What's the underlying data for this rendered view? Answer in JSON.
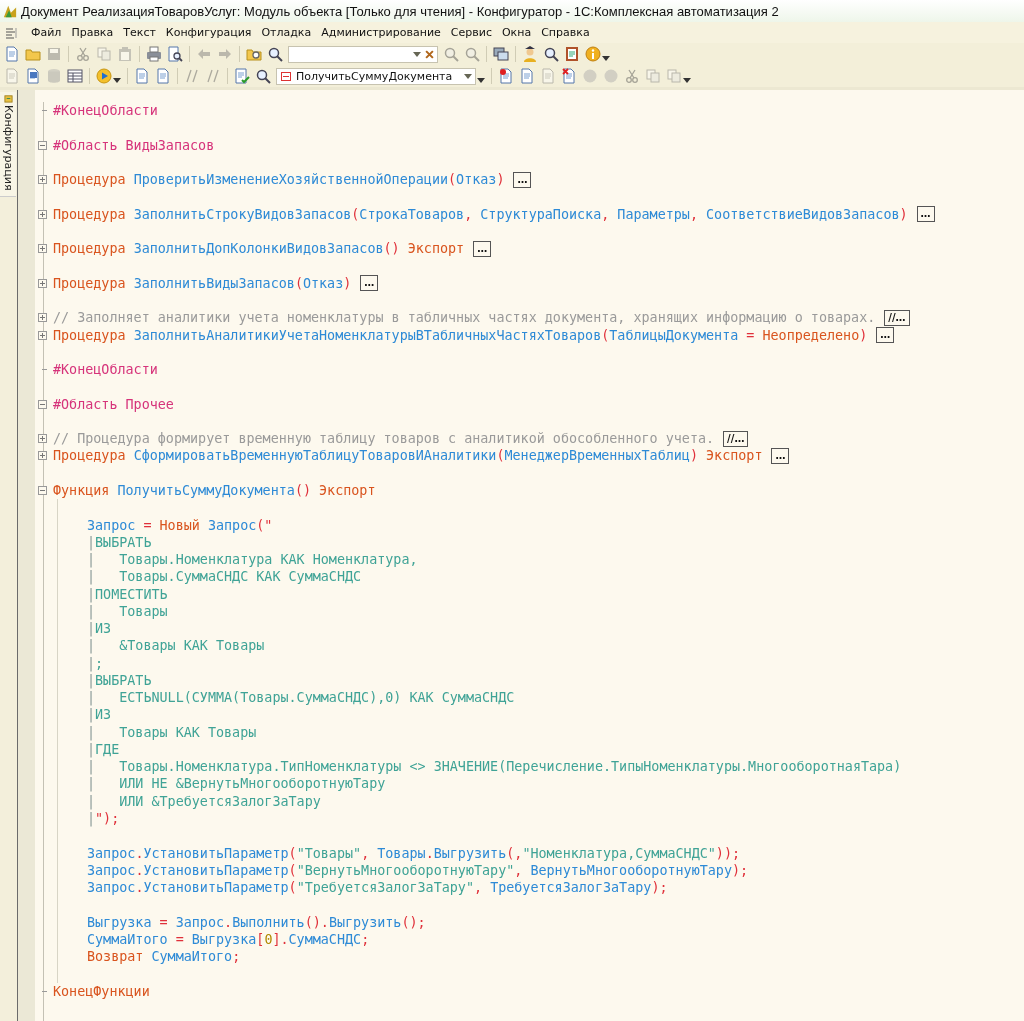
{
  "window": {
    "title": "Документ РеализацияТоваровУслуг: Модуль объекта [Только для чтения] - Конфигуратор - 1С:Комплексная автоматизация 2"
  },
  "menu": [
    "Файл",
    "Правка",
    "Текст",
    "Конфигурация",
    "Отладка",
    "Администрирование",
    "Сервис",
    "Окна",
    "Справка"
  ],
  "toolbars": [
    {
      "buttons": [
        {
          "disabled": false
        },
        {
          "disabled": false
        },
        {
          "disabled": true
        },
        {
          "disabled": true
        },
        {
          "disabled": true
        },
        {
          "disabled": true
        },
        {
          "disabled": false
        },
        {
          "disabled": false
        },
        {
          "disabled": true
        },
        {
          "disabled": true
        },
        {
          "disabled": false
        },
        {
          "disabled": false
        },
        {
          "disabled": true
        },
        {
          "disabled": true
        },
        {
          "disabled": false
        },
        {
          "disabled": false
        },
        {
          "disabled": false
        },
        {
          "disabled": false
        },
        {
          "disabled": false
        }
      ]
    },
    {
      "buttons": [
        {
          "disabled": true
        },
        {
          "disabled": false
        },
        {
          "disabled": true
        },
        {
          "disabled": false
        },
        {
          "disabled": false
        },
        {
          "disabled": false
        },
        {
          "disabled": false
        },
        {
          "disabled": true
        },
        {
          "disabled": true
        },
        {
          "disabled": false
        },
        {
          "disabled": false
        },
        {
          "disabled": false
        },
        {
          "disabled": false
        },
        {
          "disabled": true
        },
        {
          "disabled": false
        },
        {
          "disabled": true
        },
        {
          "disabled": true
        },
        {
          "disabled": true
        },
        {
          "disabled": true
        },
        {
          "disabled": true
        }
      ]
    }
  ],
  "method_selector": {
    "value": "ПолучитьСуммуДокумента"
  },
  "side_tab": {
    "label": "Конфигурация"
  },
  "editor": {
    "lines": [
      {
        "kind": "block_end",
        "tokens": [
          {
            "t": "#КонецОбласти",
            "kind": "rg"
          }
        ]
      },
      {
        "kind": "blank"
      },
      {
        "kind": "block",
        "expanded": true,
        "tokens": [
          {
            "t": "#Область ВидыЗапасов",
            "kind": "rg"
          }
        ]
      },
      {
        "kind": "blank"
      },
      {
        "kind": "block",
        "expanded": false,
        "folded_label": "…",
        "tokens": [
          {
            "t": "Процедура ",
            "kind": "kw"
          },
          {
            "t": "ПроверитьИзменениеХозяйственнойОперации",
            "kind": "id"
          },
          {
            "t": "(",
            "kind": "p"
          },
          {
            "t": "Отказ",
            "kind": "id"
          },
          {
            "t": ")",
            "kind": "p"
          }
        ]
      },
      {
        "kind": "blank"
      },
      {
        "kind": "block",
        "expanded": false,
        "folded_label": "…",
        "tokens": [
          {
            "t": "Процедура ",
            "kind": "kw"
          },
          {
            "t": "ЗаполнитьСтрокуВидовЗапасов",
            "kind": "id"
          },
          {
            "t": "(",
            "kind": "p"
          },
          {
            "t": "СтрокаТоваров",
            "kind": "id"
          },
          {
            "t": ", ",
            "kind": "p"
          },
          {
            "t": "СтруктураПоиска",
            "kind": "id"
          },
          {
            "t": ", ",
            "kind": "p"
          },
          {
            "t": "Параметры",
            "kind": "id"
          },
          {
            "t": ", ",
            "kind": "p"
          },
          {
            "t": "СоответствиеВидовЗапасов",
            "kind": "id"
          },
          {
            "t": ")",
            "kind": "p"
          }
        ]
      },
      {
        "kind": "blank"
      },
      {
        "kind": "block",
        "expanded": false,
        "folded_label": "…",
        "tokens": [
          {
            "t": "Процедура ",
            "kind": "kw"
          },
          {
            "t": "ЗаполнитьДопКолонкиВидовЗапасов",
            "kind": "id"
          },
          {
            "t": "() ",
            "kind": "p"
          },
          {
            "t": "Экспорт",
            "kind": "kw"
          }
        ]
      },
      {
        "kind": "blank"
      },
      {
        "kind": "block",
        "expanded": false,
        "folded_label": "…",
        "tokens": [
          {
            "t": "Процедура ",
            "kind": "kw"
          },
          {
            "t": "ЗаполнитьВидыЗапасов",
            "kind": "id"
          },
          {
            "t": "(",
            "kind": "p"
          },
          {
            "t": "Отказ",
            "kind": "id"
          },
          {
            "t": ")",
            "kind": "p"
          }
        ]
      },
      {
        "kind": "blank"
      },
      {
        "kind": "block",
        "expanded": false,
        "folded_label": "//…",
        "tokens": [
          {
            "t": "// Заполняет аналитики учета номенклатуры в табличных частях документа, хранящих информацию о товарах.",
            "kind": "cm"
          }
        ]
      },
      {
        "kind": "block",
        "expanded": false,
        "folded_label": "…",
        "tokens": [
          {
            "t": "Процедура ",
            "kind": "kw"
          },
          {
            "t": "ЗаполнитьАналитикиУчетаНоменклатурыВТабличныхЧастяхТоваров",
            "kind": "id"
          },
          {
            "t": "(",
            "kind": "p"
          },
          {
            "t": "ТаблицыДокумента ",
            "kind": "id"
          },
          {
            "t": "= ",
            "kind": "p"
          },
          {
            "t": "Неопределено",
            "kind": "kw"
          },
          {
            "t": ")",
            "kind": "p"
          }
        ]
      },
      {
        "kind": "blank"
      },
      {
        "kind": "block_end",
        "tokens": [
          {
            "t": "#КонецОбласти",
            "kind": "rg"
          }
        ]
      },
      {
        "kind": "blank"
      },
      {
        "kind": "block",
        "expanded": true,
        "tokens": [
          {
            "t": "#Область Прочее",
            "kind": "rg"
          }
        ]
      },
      {
        "kind": "blank"
      },
      {
        "kind": "block",
        "expanded": false,
        "folded_label": "//…",
        "tokens": [
          {
            "t": "// Процедура формирует временную таблицу товаров с аналитикой обособленного учета.",
            "kind": "cm"
          }
        ]
      },
      {
        "kind": "block",
        "expanded": false,
        "folded_label": "…",
        "tokens": [
          {
            "t": "Процедура ",
            "kind": "kw"
          },
          {
            "t": "СформироватьВременнуюТаблицуТоваровИАналитики",
            "kind": "id"
          },
          {
            "t": "(",
            "kind": "p"
          },
          {
            "t": "МенеджерВременныхТаблиц",
            "kind": "id"
          },
          {
            "t": ") ",
            "kind": "p"
          },
          {
            "t": "Экспорт",
            "kind": "kw"
          }
        ]
      },
      {
        "kind": "blank"
      },
      {
        "kind": "block",
        "expanded": true,
        "tokens": [
          {
            "t": "Функция ",
            "kind": "kw"
          },
          {
            "t": "ПолучитьСуммуДокумента",
            "kind": "id"
          },
          {
            "t": "() ",
            "kind": "p"
          },
          {
            "t": "Экспорт",
            "kind": "kw"
          }
        ],
        "children": [
          {
            "kind": "blank"
          },
          {
            "kind": "code",
            "tokens": [
              {
                "t": "Запрос ",
                "kind": "id"
              },
              {
                "t": "= ",
                "kind": "p"
              },
              {
                "t": "Новый ",
                "kind": "kw"
              },
              {
                "t": "Запрос",
                "kind": "id"
              },
              {
                "t": "(\"",
                "kind": "p"
              }
            ]
          },
          {
            "kind": "code",
            "tokens": [
              {
                "t": "|",
                "kind": "pipe"
              },
              {
                "t": "ВЫБРАТЬ",
                "kind": "q"
              }
            ]
          },
          {
            "kind": "code",
            "tokens": [
              {
                "t": "|",
                "kind": "pipe"
              },
              {
                "t": "   Товары.Номенклатура КАК Номенклатура,",
                "kind": "q"
              }
            ]
          },
          {
            "kind": "code",
            "tokens": [
              {
                "t": "|",
                "kind": "pipe"
              },
              {
                "t": "   Товары.СуммаСНДС КАК СуммаСНДС",
                "kind": "q"
              }
            ]
          },
          {
            "kind": "code",
            "tokens": [
              {
                "t": "|",
                "kind": "pipe"
              },
              {
                "t": "ПОМЕСТИТЬ",
                "kind": "q"
              }
            ]
          },
          {
            "kind": "code",
            "tokens": [
              {
                "t": "|",
                "kind": "pipe"
              },
              {
                "t": "   Товары",
                "kind": "q"
              }
            ]
          },
          {
            "kind": "code",
            "tokens": [
              {
                "t": "|",
                "kind": "pipe"
              },
              {
                "t": "ИЗ",
                "kind": "q"
              }
            ]
          },
          {
            "kind": "code",
            "tokens": [
              {
                "t": "|",
                "kind": "pipe"
              },
              {
                "t": "   &Товары КАК Товары",
                "kind": "q"
              }
            ]
          },
          {
            "kind": "code",
            "tokens": [
              {
                "t": "|",
                "kind": "pipe"
              },
              {
                "t": ";",
                "kind": "q"
              }
            ]
          },
          {
            "kind": "code",
            "tokens": [
              {
                "t": "|",
                "kind": "pipe"
              },
              {
                "t": "ВЫБРАТЬ",
                "kind": "q"
              }
            ]
          },
          {
            "kind": "code",
            "tokens": [
              {
                "t": "|",
                "kind": "pipe"
              },
              {
                "t": "   ЕСТЬNULL(СУММА(Товары.СуммаСНДС),0) КАК СуммаСНДС",
                "kind": "q"
              }
            ]
          },
          {
            "kind": "code",
            "tokens": [
              {
                "t": "|",
                "kind": "pipe"
              },
              {
                "t": "ИЗ",
                "kind": "q"
              }
            ]
          },
          {
            "kind": "code",
            "tokens": [
              {
                "t": "|",
                "kind": "pipe"
              },
              {
                "t": "   Товары КАК Товары",
                "kind": "q"
              }
            ]
          },
          {
            "kind": "code",
            "tokens": [
              {
                "t": "|",
                "kind": "pipe"
              },
              {
                "t": "ГДЕ",
                "kind": "q"
              }
            ]
          },
          {
            "kind": "code",
            "tokens": [
              {
                "t": "|",
                "kind": "pipe"
              },
              {
                "t": "   Товары.Номенклатура.ТипНоменклатуры <> ЗНАЧЕНИЕ(Перечисление.ТипыНоменклатуры.МногооборотнаяТара)",
                "kind": "q"
              }
            ]
          },
          {
            "kind": "code",
            "tokens": [
              {
                "t": "|",
                "kind": "pipe"
              },
              {
                "t": "   ИЛИ НЕ &ВернутьМногооборотнуюТару",
                "kind": "q"
              }
            ]
          },
          {
            "kind": "code",
            "tokens": [
              {
                "t": "|",
                "kind": "pipe"
              },
              {
                "t": "   ИЛИ &ТребуетсяЗалогЗаТару",
                "kind": "q"
              }
            ]
          },
          {
            "kind": "code",
            "tokens": [
              {
                "t": "|",
                "kind": "pipe"
              },
              {
                "t": "\");",
                "kind": "p"
              }
            ]
          },
          {
            "kind": "blank"
          },
          {
            "kind": "code",
            "tokens": [
              {
                "t": "Запрос",
                "kind": "id"
              },
              {
                "t": ".",
                "kind": "p"
              },
              {
                "t": "УстановитьПараметр",
                "kind": "id"
              },
              {
                "t": "(",
                "kind": "p"
              },
              {
                "t": "\"Товары\"",
                "kind": "q"
              },
              {
                "t": ", ",
                "kind": "p"
              },
              {
                "t": "Товары",
                "kind": "id"
              },
              {
                "t": ".",
                "kind": "p"
              },
              {
                "t": "Выгрузить",
                "kind": "id"
              },
              {
                "t": "(,",
                "kind": "p"
              },
              {
                "t": "\"Номенклатура,СуммаСНДС\"",
                "kind": "q"
              },
              {
                "t": "));",
                "kind": "p"
              }
            ]
          },
          {
            "kind": "code",
            "tokens": [
              {
                "t": "Запрос",
                "kind": "id"
              },
              {
                "t": ".",
                "kind": "p"
              },
              {
                "t": "УстановитьПараметр",
                "kind": "id"
              },
              {
                "t": "(",
                "kind": "p"
              },
              {
                "t": "\"ВернутьМногооборотнуюТару\"",
                "kind": "q"
              },
              {
                "t": ", ",
                "kind": "p"
              },
              {
                "t": "ВернутьМногооборотнуюТару",
                "kind": "id"
              },
              {
                "t": ");",
                "kind": "p"
              }
            ]
          },
          {
            "kind": "code",
            "tokens": [
              {
                "t": "Запрос",
                "kind": "id"
              },
              {
                "t": ".",
                "kind": "p"
              },
              {
                "t": "УстановитьПараметр",
                "kind": "id"
              },
              {
                "t": "(",
                "kind": "p"
              },
              {
                "t": "\"ТребуетсяЗалогЗаТару\"",
                "kind": "q"
              },
              {
                "t": ", ",
                "kind": "p"
              },
              {
                "t": "ТребуетсяЗалогЗаТару",
                "kind": "id"
              },
              {
                "t": ");",
                "kind": "p"
              }
            ]
          },
          {
            "kind": "blank"
          },
          {
            "kind": "code",
            "tokens": [
              {
                "t": "Выгрузка ",
                "kind": "id"
              },
              {
                "t": "= ",
                "kind": "p"
              },
              {
                "t": "Запрос",
                "kind": "id"
              },
              {
                "t": ".",
                "kind": "p"
              },
              {
                "t": "Выполнить",
                "kind": "id"
              },
              {
                "t": "().",
                "kind": "p"
              },
              {
                "t": "Выгрузить",
                "kind": "id"
              },
              {
                "t": "();",
                "kind": "p"
              }
            ]
          },
          {
            "kind": "code",
            "tokens": [
              {
                "t": "СуммаИтого ",
                "kind": "id"
              },
              {
                "t": "= ",
                "kind": "p"
              },
              {
                "t": "Выгрузка",
                "kind": "id"
              },
              {
                "t": "[",
                "kind": "p"
              },
              {
                "t": "0",
                "kind": "n"
              },
              {
                "t": "].",
                "kind": "p"
              },
              {
                "t": "СуммаСНДС",
                "kind": "id"
              },
              {
                "t": ";",
                "kind": "p"
              }
            ]
          },
          {
            "kind": "code",
            "tokens": [
              {
                "t": "Возврат ",
                "kind": "kw"
              },
              {
                "t": "СуммаИтого",
                "kind": "id"
              },
              {
                "t": ";",
                "kind": "p"
              }
            ]
          },
          {
            "kind": "blank"
          }
        ]
      },
      {
        "kind": "block_end",
        "tokens": [
          {
            "t": "КонецФункции",
            "kind": "kw"
          }
        ]
      }
    ]
  }
}
